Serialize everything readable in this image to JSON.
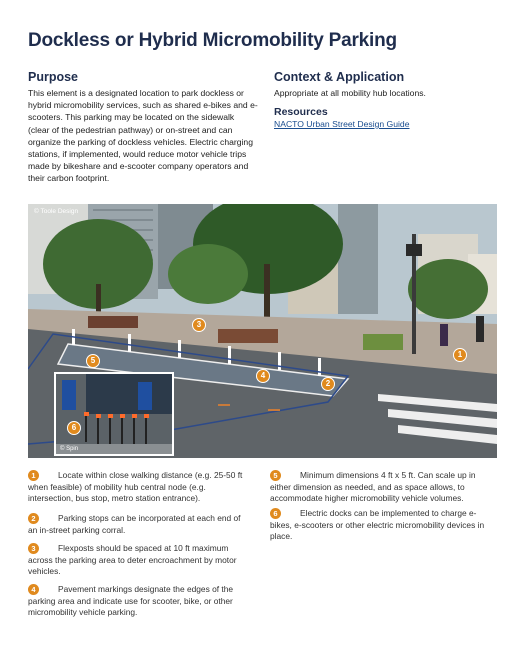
{
  "page": {
    "title": "Dockless or Hybrid Micromobility Parking"
  },
  "purpose": {
    "heading": "Purpose",
    "text": "This element is a designated location to park dockless or hybrid micromobility services, such as shared e-bikes and e-scooters. This parking may be located on the sidewalk (clear of the pedestrian pathway) or on-street and can organize the parking of dockless vehicles. Electric charging stations, if implemented, would reduce motor vehicle trips made by bikeshare and e-scooter company operators and their carbon footprint."
  },
  "context": {
    "heading": "Context & Application",
    "text": "Appropriate at all mobility hub locations."
  },
  "resources": {
    "heading": "Resources",
    "link_label": "NACTO Urban Street Design Guide"
  },
  "photo": {
    "credit": "© Toole Design",
    "inset_credit": "© Spin",
    "markers": [
      "1",
      "2",
      "3",
      "4",
      "5",
      "6"
    ]
  },
  "notes": [
    {
      "num": "1",
      "text": "Locate within close walking distance (e.g. 25-50 ft when feasible) of mobility hub central node (e.g. intersection, bus stop, metro station entrance)."
    },
    {
      "num": "2",
      "text": "Parking stops can be incorporated at each end of an in-street parking corral."
    },
    {
      "num": "3",
      "text": "Flexposts should be spaced at 10 ft maximum across the parking area to deter encroachment by motor vehicles."
    },
    {
      "num": "4",
      "text": "Pavement markings designate the edges of the parking area and indicate use for scooter, bike, or other micromobility vehicle parking."
    },
    {
      "num": "5",
      "text": "Minimum dimensions 4 ft x 5 ft. Can scale up in either dimension as needed, and as space allows, to accommodate higher micromobility vehicle volumes."
    },
    {
      "num": "6",
      "text": "Electric docks can be implemented to charge e-bikes, e-scooters or other electric micromobility devices in place."
    }
  ],
  "colors": {
    "heading": "#1f2d4d",
    "accent_marker": "#e08a1e",
    "link": "#1a4d8f"
  }
}
